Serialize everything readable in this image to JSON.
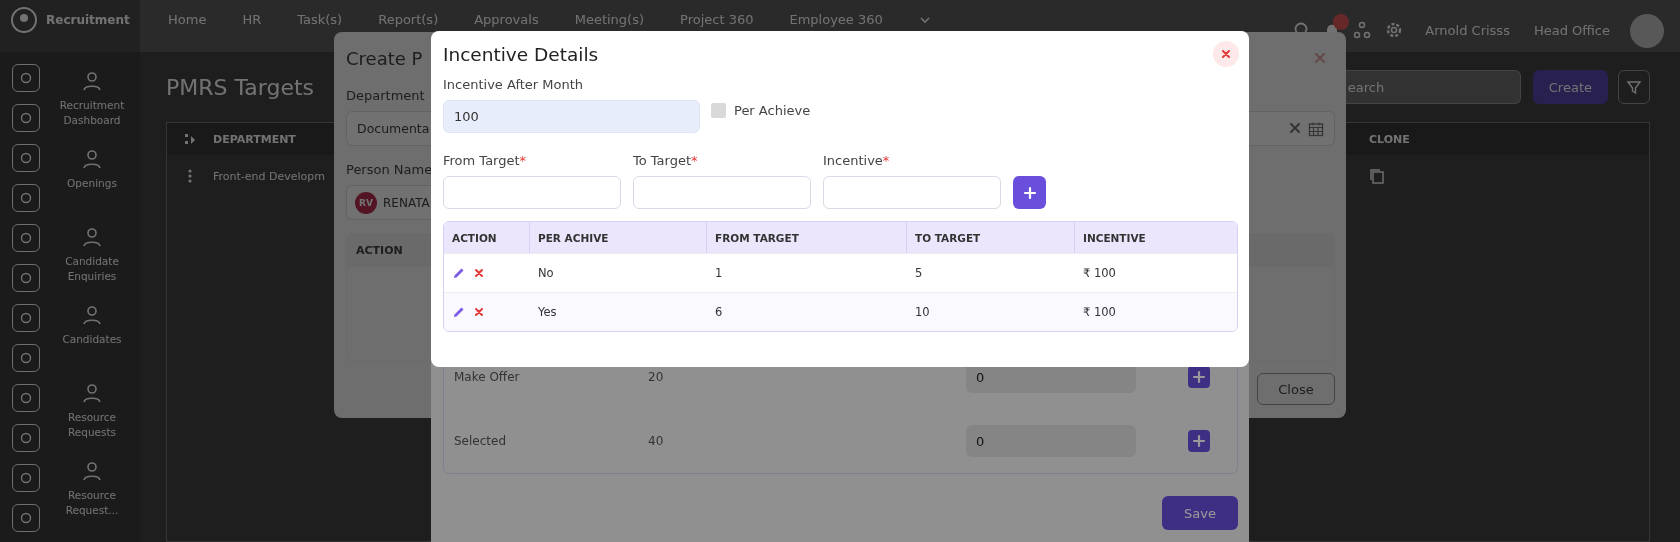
{
  "top_nav": {
    "brand": "Recruitment",
    "items": [
      {
        "label": "Home"
      },
      {
        "label": "HR"
      },
      {
        "label": "Task(s)"
      },
      {
        "label": "Report(s)"
      },
      {
        "label": "Approvals"
      },
      {
        "label": "Meeting(s)"
      },
      {
        "label": "Project 360"
      },
      {
        "label": "Employee 360"
      }
    ],
    "user_name": "Arnold Crisss",
    "branch": "Head Office"
  },
  "sidebar": {
    "items": [
      {
        "label": "Recruitment Dashboard"
      },
      {
        "label": "Openings"
      },
      {
        "label": "Candidate Enquiries"
      },
      {
        "label": "Candidates"
      },
      {
        "label": "Resource Requests"
      },
      {
        "label": "Resource Request..."
      }
    ]
  },
  "page": {
    "title": "PMRS Targets",
    "search": {
      "placeholder": "earch"
    },
    "create_button": "Create",
    "table": {
      "columns": [
        "DEPARTMENT",
        "CLONE"
      ],
      "rows": [
        {
          "department": "Front-end Developm"
        }
      ]
    }
  },
  "create_modal": {
    "title": "Create P",
    "department_label": "Department",
    "department_value": "Documenta",
    "person_label": "Person Name",
    "person": {
      "initials": "RV",
      "name": "RENATA"
    },
    "table": {
      "columns": [
        "ACTION"
      ]
    },
    "close_button": "Close"
  },
  "stage_modal": {
    "rows": [
      {
        "stage": "Make Offer",
        "column_2": "20",
        "value": "0"
      },
      {
        "stage": "Selected",
        "column_2": "40",
        "value": "0"
      }
    ],
    "save_button": "Save"
  },
  "incentive_modal": {
    "title": "Incentive Details",
    "after_month": {
      "label": "Incentive After Month",
      "value": "100"
    },
    "per_achieve": {
      "label": "Per Achieve",
      "checked": false
    },
    "fields": [
      {
        "label": "From Target",
        "required_mark": "*"
      },
      {
        "label": "To Target",
        "required_mark": "*"
      },
      {
        "label": "Incentive",
        "required_mark": "*"
      }
    ],
    "table": {
      "columns": [
        "ACTION",
        "PER ACHIVE",
        "FROM TARGET",
        "TO TARGET",
        "INCENTIVE"
      ],
      "rows": [
        {
          "per_achive": "No",
          "from_target": "1",
          "to_target": "5",
          "incentive": "₹ 100"
        },
        {
          "per_achive": "Yes",
          "from_target": "6",
          "to_target": "10",
          "incentive": "₹ 100"
        }
      ]
    }
  }
}
